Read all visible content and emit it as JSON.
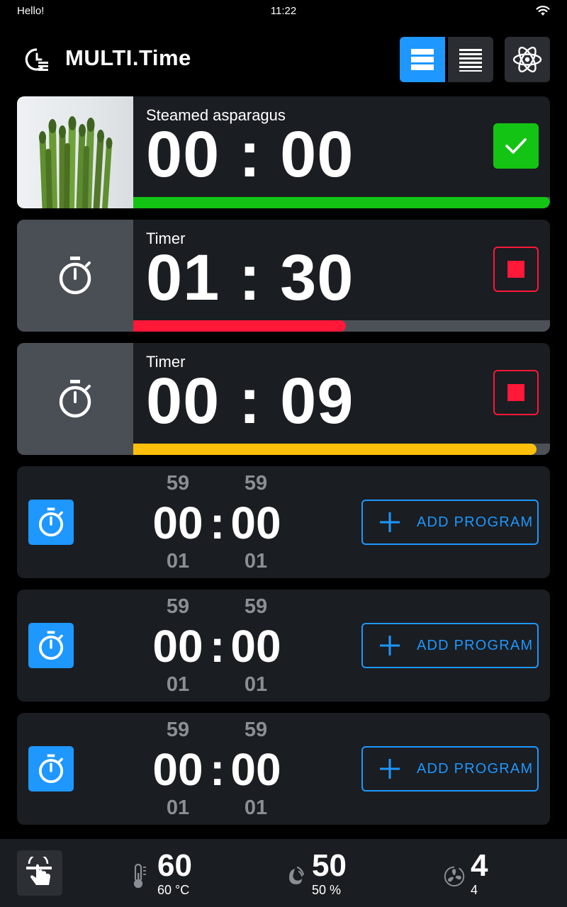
{
  "status": {
    "left_text": "Hello!",
    "time": "11:22"
  },
  "header": {
    "title": "MULTI.Time"
  },
  "cards": [
    {
      "name": "Steamed asparagus",
      "time": "00 : 00",
      "progress": 1.0,
      "color": "#14c414",
      "action": "done"
    },
    {
      "name": "Timer",
      "time": "01 : 30",
      "progress": 0.51,
      "color": "#ff1838",
      "action": "stop"
    },
    {
      "name": "Timer",
      "time": "00 : 09",
      "progress": 0.967,
      "color": "#ffbf0a",
      "action": "stop"
    }
  ],
  "empty_timers": [
    {
      "hours_above": "59",
      "hours": "00",
      "hours_below": "01",
      "minutes_above": "59",
      "minutes": "00",
      "minutes_below": "01",
      "colon": ":",
      "button_label": "ADD PROGRAM"
    },
    {
      "hours_above": "59",
      "hours": "00",
      "hours_below": "01",
      "minutes_above": "59",
      "minutes": "00",
      "minutes_below": "01",
      "colon": ":",
      "button_label": "ADD PROGRAM"
    },
    {
      "hours_above": "59",
      "hours": "00",
      "hours_below": "01",
      "minutes_above": "59",
      "minutes": "00",
      "minutes_below": "01",
      "colon": ":",
      "button_label": "ADD PROGRAM"
    }
  ],
  "bottom": {
    "temperature": {
      "value": "60",
      "sub": "60 °C",
      "icon": "thermometer-icon"
    },
    "humidity": {
      "value": "50",
      "sub": "50 %",
      "icon": "humidity-icon"
    },
    "fan": {
      "value": "4",
      "sub": "4",
      "icon": "fan-icon"
    }
  },
  "colors": {
    "accent": "#1e97ff",
    "done": "#14c414",
    "stop": "#ff1838",
    "warn": "#ffbf0a",
    "card_bg": "#1a1d21"
  }
}
